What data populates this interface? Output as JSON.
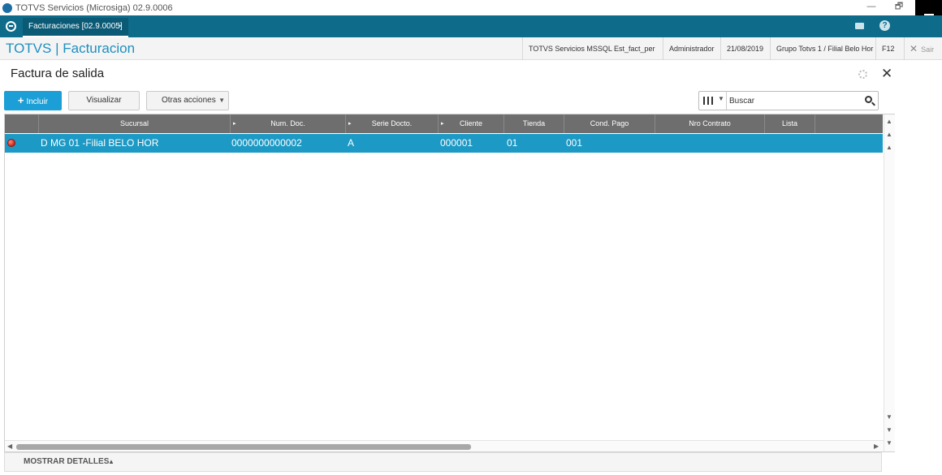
{
  "window": {
    "title": "TOTVS Servicios (Microsiga) 02.9.0006",
    "minimize_label": "—",
    "restore_label": "🗗"
  },
  "tabbar": {
    "active_tab": "Facturaciones [02.9.0005]",
    "tab_close": "×",
    "help_label": "?"
  },
  "header": {
    "brand": "TOTVS | Facturacion",
    "environment": "TOTVS Servicios MSSQL Est_fact_per",
    "user": "Administrador",
    "date": "21/08/2019",
    "branch": "Grupo Totvs 1 / Filial Belo Hor",
    "shortcut": "F12",
    "exit_label": "Sair",
    "exit_icon": "✕"
  },
  "page": {
    "title": "Factura de salida",
    "close_label": "✕"
  },
  "toolbar": {
    "include_label": "Incluir",
    "include_icon": "+",
    "view_label": "Visualizar",
    "more_actions_label": "Otras acciones",
    "more_actions_caret": "▼"
  },
  "search": {
    "value": "Buscar",
    "dropdown_caret": "▼"
  },
  "grid": {
    "columns": [
      "Sucursal",
      "Num. Doc.",
      "Serie Docto.",
      "Cliente",
      "Tienda",
      "Cond. Pago",
      "Nro Contrato",
      "Lista"
    ],
    "sort_marker": "▸",
    "rows": [
      {
        "status": "red",
        "sucursal": "D MG 01 -Filial BELO HOR",
        "num_doc": "0000000000002",
        "serie": "A",
        "cliente": "000001",
        "tienda": "01",
        "cond_pago": "001",
        "nro_contrato": "",
        "lista": ""
      }
    ]
  },
  "scroll": {
    "up": "▲",
    "down": "▼",
    "left": "◀",
    "right": "▶"
  },
  "footer": {
    "details_label": "MOSTRAR DETALLES",
    "details_caret": "▲"
  },
  "colors": {
    "tabbar": "#0e6b8a",
    "brand": "#1f8fbf",
    "primary_button": "#1b9fd6",
    "selected_row": "#1c99c4",
    "grid_header": "#6e6e6e",
    "status_red": "#d0221a"
  }
}
